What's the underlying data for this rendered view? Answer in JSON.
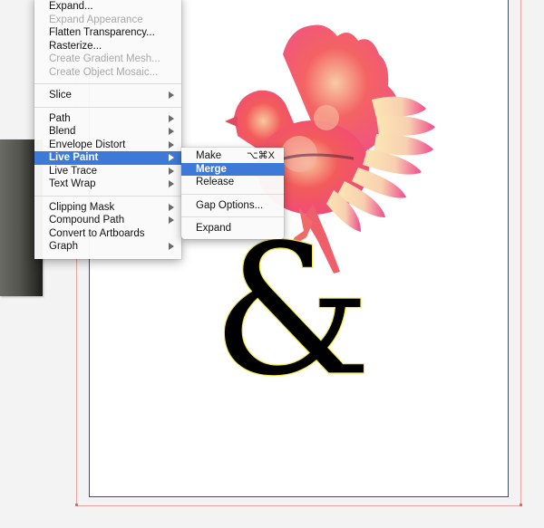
{
  "app": "Adobe Illustrator",
  "colors": {
    "menu_highlight": "#3d79d6",
    "bleed_guide": "#e8a3a3",
    "artboard_border": "#4a4a5a",
    "disabled_text": "#a8a8a8"
  },
  "object_menu": {
    "items": [
      {
        "label": "Expand...",
        "disabled": false
      },
      {
        "label": "Expand Appearance",
        "disabled": true
      },
      {
        "label": "Flatten Transparency...",
        "disabled": false
      },
      {
        "label": "Rasterize...",
        "disabled": false
      },
      {
        "label": "Create Gradient Mesh...",
        "disabled": true
      },
      {
        "label": "Create Object Mosaic...",
        "disabled": true
      },
      {
        "label": "Slice",
        "submenu": true
      },
      {
        "label": "Path",
        "submenu": true
      },
      {
        "label": "Blend",
        "submenu": true
      },
      {
        "label": "Envelope Distort",
        "submenu": true
      },
      {
        "label": "Live Paint",
        "submenu": true,
        "highlighted": true
      },
      {
        "label": "Live Trace",
        "submenu": true
      },
      {
        "label": "Text Wrap",
        "submenu": true
      },
      {
        "label": "Clipping Mask",
        "submenu": true
      },
      {
        "label": "Compound Path",
        "submenu": true
      },
      {
        "label": "Convert to Artboards",
        "submenu": false
      },
      {
        "label": "Graph",
        "submenu": true
      }
    ]
  },
  "live_paint_submenu": {
    "items": [
      {
        "label": "Make",
        "shortcut": "⌥⌘X"
      },
      {
        "label": "Merge",
        "highlighted": true
      },
      {
        "label": "Release"
      },
      {
        "label": "Gap Options..."
      },
      {
        "label": "Expand"
      }
    ]
  },
  "artwork": {
    "glyph": "&",
    "bird_icon": "bird-illustration"
  }
}
